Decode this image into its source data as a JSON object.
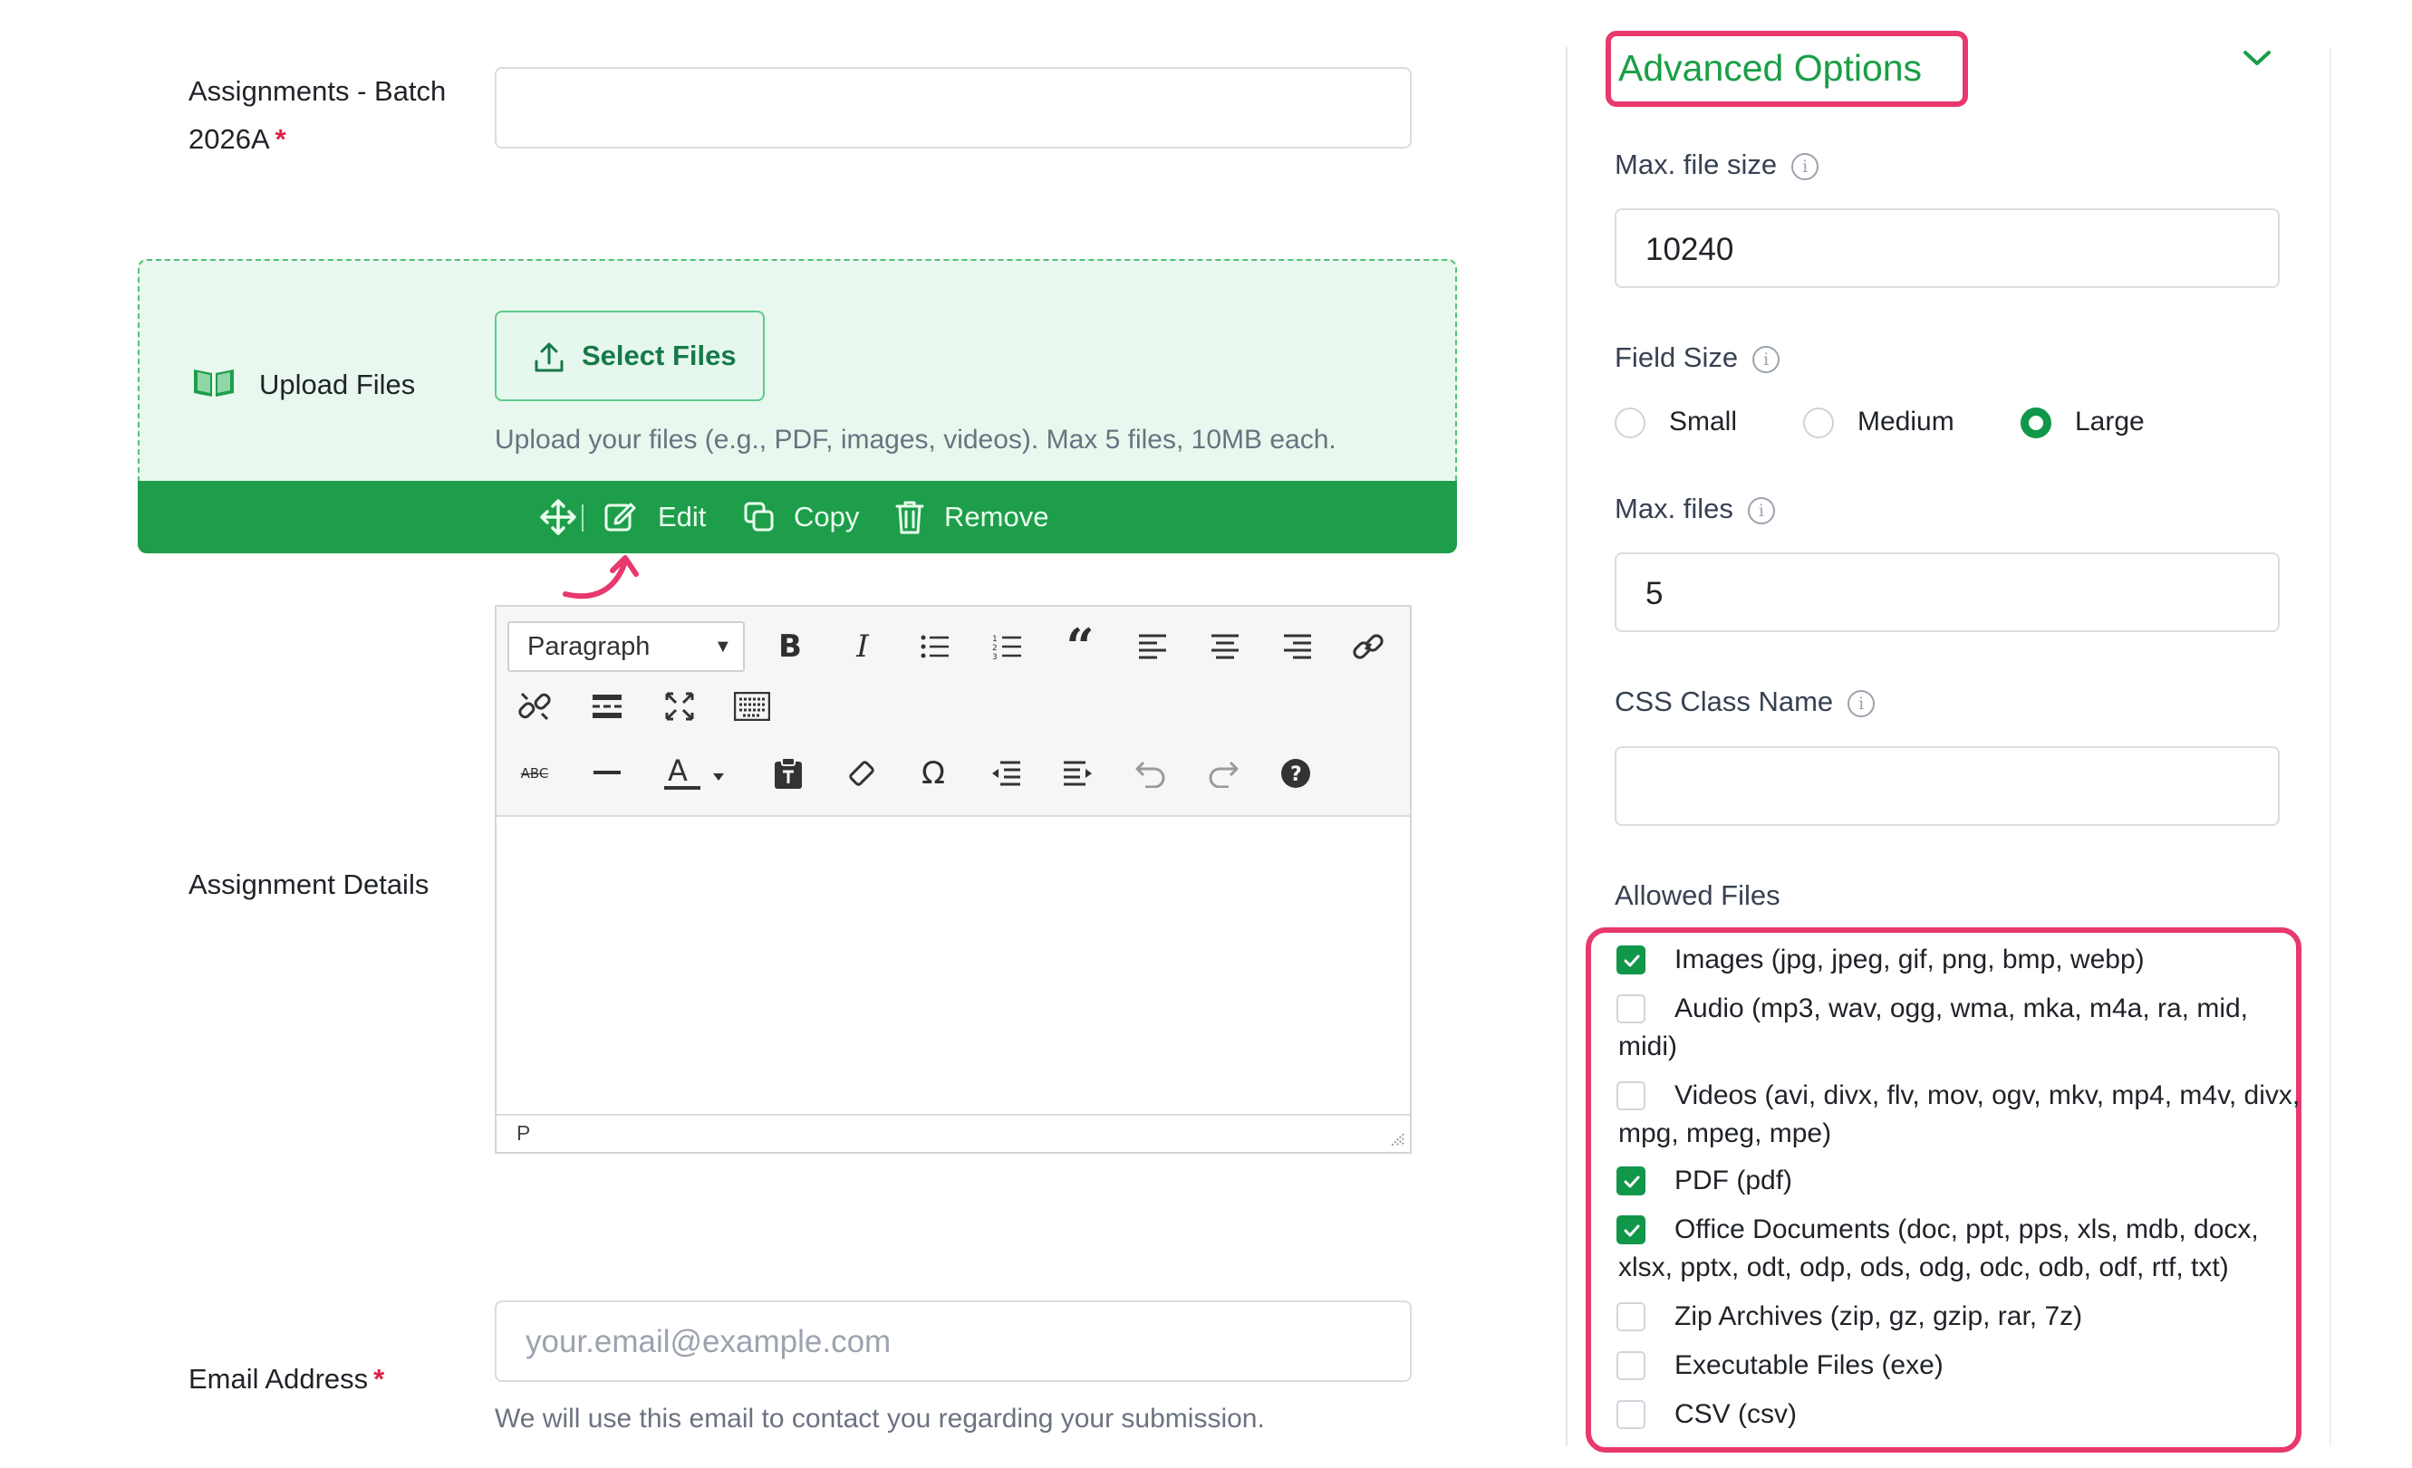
{
  "form": {
    "assignments_label": "Assignments - Batch 2026A",
    "required_mark": "*",
    "assignments_value": "",
    "upload_label": "Upload Files",
    "select_files_label": "Select Files",
    "upload_help": "Upload your files (e.g., PDF, images, videos). Max 5 files, 10MB each.",
    "field_toolbar": {
      "edit": "Edit",
      "copy": "Copy",
      "remove": "Remove"
    },
    "details_label": "Assignment Details",
    "editor": {
      "block_format": "Paragraph",
      "status_path": "P",
      "content": ""
    },
    "email_label": "Email Address",
    "email_placeholder": "your.email@example.com",
    "email_help": "We will use this email to contact you regarding your submission."
  },
  "advanced": {
    "title": "Advanced Options",
    "max_file_size_label": "Max. file size",
    "max_file_size_value": "10240",
    "field_size_label": "Field Size",
    "field_size_options": [
      "Small",
      "Medium",
      "Large"
    ],
    "field_size_selected": "Large",
    "max_files_label": "Max. files",
    "max_files_value": "5",
    "css_class_label": "CSS Class Name",
    "css_class_value": "",
    "allowed_files_label": "Allowed Files",
    "allowed_files": [
      {
        "label": "Images (jpg, jpeg, gif, png, bmp, webp)",
        "checked": true
      },
      {
        "label": "Audio (mp3, wav, ogg, wma, mka, m4a, ra, mid, midi)",
        "checked": false
      },
      {
        "label": "Videos (avi, divx, flv, mov, ogv, mkv, mp4, m4v, divx, mpg, mpeg, mpe)",
        "checked": false
      },
      {
        "label": "PDF (pdf)",
        "checked": true
      },
      {
        "label": "Office Documents (doc, ppt, pps, xls, mdb, docx, xlsx, pptx, odt, odp, ods, odg, odc, odb, odf, rtf, txt)",
        "checked": true
      },
      {
        "label": "Zip Archives (zip, gz, gzip, rar, 7z)",
        "checked": false
      },
      {
        "label": "Executable Files (exe)",
        "checked": false
      },
      {
        "label": "CSV (csv)",
        "checked": false
      }
    ]
  },
  "colors": {
    "accent_green": "#1e9e4a",
    "highlight_pink": "#e8386d",
    "required_red": "#e11d48"
  },
  "icons": [
    "book-open-icon",
    "upload-icon",
    "move-icon",
    "edit-icon",
    "copy-icon",
    "trash-icon",
    "chevron-down-icon",
    "info-icon",
    "check-icon",
    "curved-arrow-icon"
  ]
}
